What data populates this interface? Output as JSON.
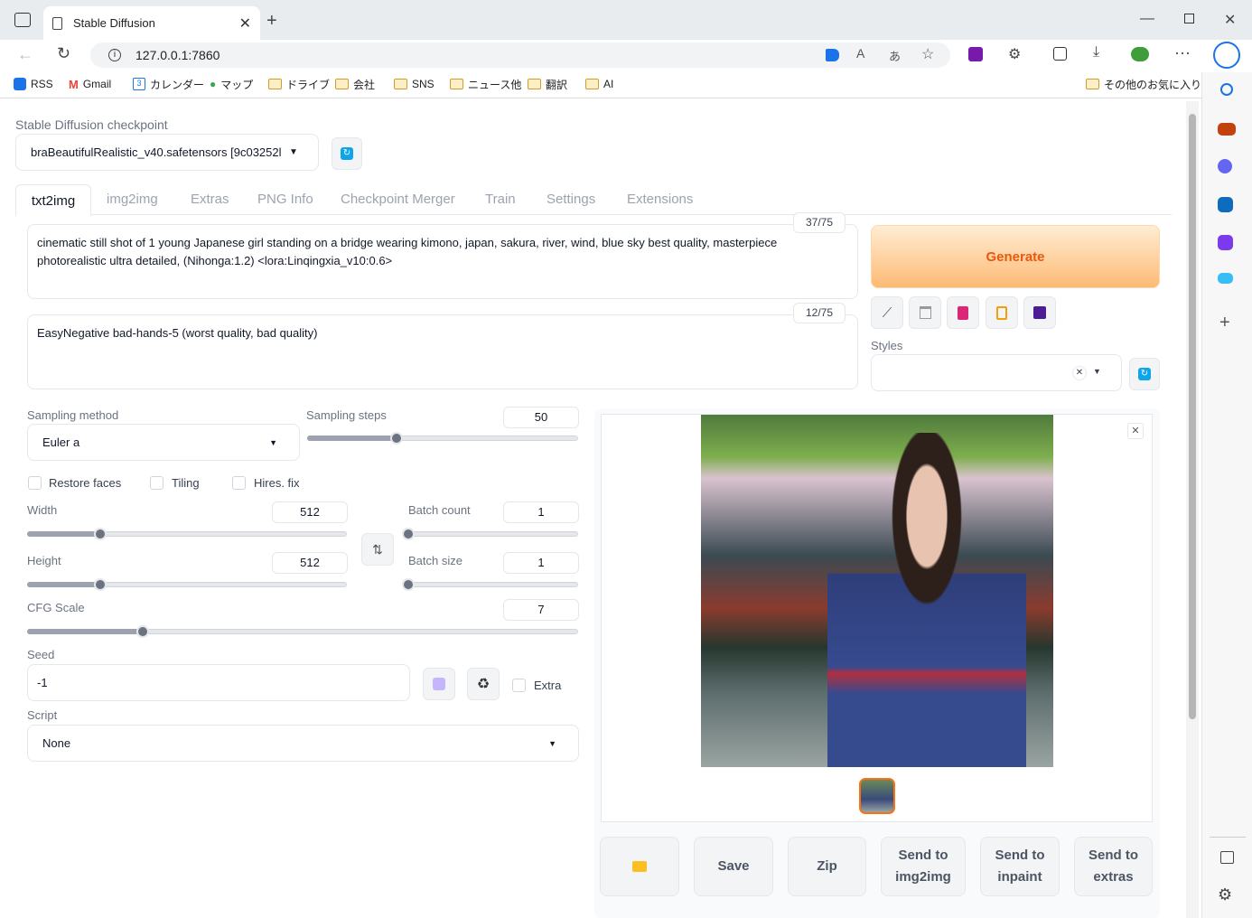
{
  "browser": {
    "tab_title": "Stable Diffusion",
    "url": "127.0.0.1:7860",
    "bookmarks": [
      "RSS",
      "Gmail",
      "カレンダー",
      "マップ",
      "ドライブ",
      "会社",
      "SNS",
      "ニュース他",
      "翻訳",
      "AI"
    ],
    "other_favorites": "その他のお気に入り"
  },
  "checkpoint": {
    "label": "Stable Diffusion checkpoint",
    "value": "braBeautifulRealistic_v40.safetensors [9c03252l"
  },
  "tabs": [
    "txt2img",
    "img2img",
    "Extras",
    "PNG Info",
    "Checkpoint Merger",
    "Train",
    "Settings",
    "Extensions"
  ],
  "prompt": {
    "text": "cinematic still shot of 1 young Japanese girl standing on a bridge wearing kimono, japan, sakura, river, wind, blue sky best quality, masterpiece photorealistic ultra detailed, (Nihonga:1.2) <lora:Linqingxia_v10:0.6>",
    "token_count": "37/75"
  },
  "negative_prompt": {
    "text": "EasyNegative bad-hands-5 (worst quality, bad quality)",
    "token_count": "12/75"
  },
  "generate_label": "Generate",
  "styles_label": "Styles",
  "sampling": {
    "method_label": "Sampling method",
    "method_value": "Euler a",
    "steps_label": "Sampling steps",
    "steps_value": "50",
    "steps_fraction": 0.33
  },
  "checkboxes": {
    "restore_faces": "Restore faces",
    "tiling": "Tiling",
    "hires_fix": "Hires. fix",
    "extra": "Extra"
  },
  "width": {
    "label": "Width",
    "value": "512",
    "fraction": 0.23
  },
  "height": {
    "label": "Height",
    "value": "512",
    "fraction": 0.23
  },
  "batch_count": {
    "label": "Batch count",
    "value": "1",
    "fraction": 0
  },
  "batch_size": {
    "label": "Batch size",
    "value": "1",
    "fraction": 0
  },
  "cfg": {
    "label": "CFG Scale",
    "value": "7",
    "fraction": 0.21
  },
  "seed": {
    "label": "Seed",
    "value": "-1"
  },
  "script": {
    "label": "Script",
    "value": "None"
  },
  "actions": {
    "save": "Save",
    "zip": "Zip",
    "send_img2img": "Send to\nimg2img",
    "send_inpaint": "Send to\ninpaint",
    "send_extras": "Send to\nextras"
  },
  "colors": {
    "generate_gradient_start": "#fed7aa",
    "generate_text": "#ea580c",
    "accent_blue": "#0ea5e9"
  }
}
